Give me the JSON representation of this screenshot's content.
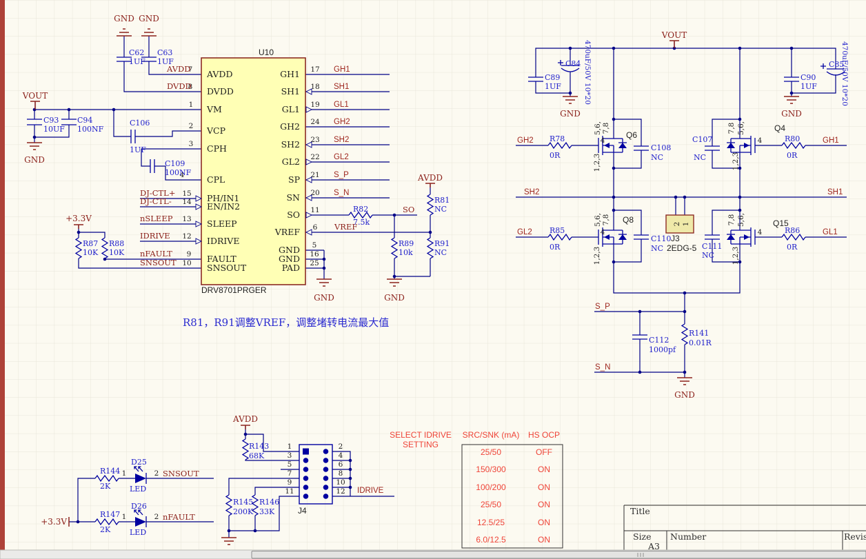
{
  "power": {
    "gnd": "GND",
    "vout": "VOUT",
    "avdd": "AVDD",
    "dvdd": "DVDD",
    "p33": "+3.3V"
  },
  "nets": {
    "so": "SO",
    "vref": "VREF",
    "gh1": "GH1",
    "sh1": "SH1",
    "gl1": "GL1",
    "gh2": "GH2",
    "sh2": "SH2",
    "gl2": "GL2",
    "sp": "S_P",
    "sn": "S_N",
    "idrive": "IDRIVE",
    "snsout": "SNSOUT",
    "nfault": "nFAULT",
    "nsleep": "nSLEEP",
    "djp": "DJ-CTL+",
    "djm": "DJ-CTL-"
  },
  "ic": {
    "refdes": "U10",
    "part": "DRV8701PRGER",
    "left_pins": [
      {
        "num": "7",
        "name": "AVDD"
      },
      {
        "num": "8",
        "name": "DVDD"
      },
      {
        "num": "1",
        "name": "VM"
      },
      {
        "num": "2",
        "name": "VCP"
      },
      {
        "num": "3",
        "name": "CPH"
      },
      {
        "num": "4",
        "name": "CPL"
      },
      {
        "num": "15",
        "name": "PH/IN1"
      },
      {
        "num": "14",
        "name": "EN/IN2"
      },
      {
        "num": "13",
        "name": "SLEEP"
      },
      {
        "num": "12",
        "name": "IDRIVE"
      },
      {
        "num": "9",
        "name": "FAULT"
      },
      {
        "num": "10",
        "name": "SNSOUT"
      }
    ],
    "right_pins": [
      {
        "num": "17",
        "name": "GH1"
      },
      {
        "num": "18",
        "name": "SH1"
      },
      {
        "num": "19",
        "name": "GL1"
      },
      {
        "num": "24",
        "name": "GH2"
      },
      {
        "num": "23",
        "name": "SH2"
      },
      {
        "num": "22",
        "name": "GL2"
      },
      {
        "num": "21",
        "name": "SP"
      },
      {
        "num": "20",
        "name": "SN"
      },
      {
        "num": "11",
        "name": "SO"
      },
      {
        "num": "6",
        "name": "VREF"
      },
      {
        "num": "5",
        "name": "GND"
      },
      {
        "num": "16",
        "name": "GND"
      },
      {
        "num": "25",
        "name": "PAD"
      }
    ]
  },
  "components": {
    "c62": {
      "ref": "C62",
      "val": "1UF"
    },
    "c63": {
      "ref": "C63",
      "val": "1UF"
    },
    "c93": {
      "ref": "C93",
      "val": "10UF"
    },
    "c94": {
      "ref": "C94",
      "val": "100NF"
    },
    "c106": {
      "ref": "C106",
      "val": "1UF"
    },
    "c109": {
      "ref": "C109",
      "val": "100NF"
    },
    "r87": {
      "ref": "R87",
      "val": "10K"
    },
    "r88": {
      "ref": "R88",
      "val": "10K"
    },
    "r82": {
      "ref": "R82",
      "val": "7.5k"
    },
    "r81": {
      "ref": "R81",
      "val": "NC"
    },
    "r89": {
      "ref": "R89",
      "val": "10k"
    },
    "r91": {
      "ref": "R91",
      "val": "NC"
    },
    "c89": {
      "ref": "C89",
      "val": "1UF"
    },
    "c84": {
      "ref": "C84",
      "val": "470uF/50V 10*20"
    },
    "c90": {
      "ref": "C90",
      "val": "1UF"
    },
    "c85": {
      "ref": "C85",
      "val": "470uF/50V 10*20"
    },
    "r78": {
      "ref": "R78",
      "val": "0R"
    },
    "r80": {
      "ref": "R80",
      "val": "0R"
    },
    "r85": {
      "ref": "R85",
      "val": "0R"
    },
    "r86": {
      "ref": "R86",
      "val": "0R"
    },
    "q6": {
      "ref": "Q6"
    },
    "q4": {
      "ref": "Q4"
    },
    "q8": {
      "ref": "Q8"
    },
    "q15": {
      "ref": "Q15"
    },
    "c108": {
      "ref": "C108",
      "val": "NC"
    },
    "c107": {
      "ref": "C107",
      "val": "NC"
    },
    "c110": {
      "ref": "C110",
      "val": "NC"
    },
    "c111": {
      "ref": "C111",
      "val": "NC"
    },
    "j3": {
      "ref": "J3",
      "val": "2EDG-5",
      "pin1": "1",
      "pin2": "2"
    },
    "c112": {
      "ref": "C112",
      "val": "1000pf"
    },
    "r141": {
      "ref": "R141",
      "val": "0.01R"
    },
    "r143": {
      "ref": "R143",
      "val": "68K"
    },
    "r145": {
      "ref": "R145",
      "val": "200K"
    },
    "r146": {
      "ref": "R146",
      "val": "33K"
    },
    "j4": {
      "ref": "J4",
      "left_pins": [
        "1",
        "3",
        "5",
        "7",
        "9",
        "11"
      ],
      "right_pins": [
        "2",
        "4",
        "6",
        "8",
        "10",
        "12"
      ]
    },
    "r144": {
      "ref": "R144",
      "val": "2K"
    },
    "r147": {
      "ref": "R147",
      "val": "2K"
    },
    "d25": {
      "ref": "D25",
      "val": "LED"
    },
    "d26": {
      "ref": "D26",
      "val": "LED"
    }
  },
  "mosfet": {
    "gate_pin": "4",
    "drain_pins_a": "5,6,",
    "drain_pins_b": "7,8",
    "source_pins": "1,2,3"
  },
  "led_pins": {
    "a": "1",
    "k": "2"
  },
  "annotation": "R81，R91调整VREF，调整堵转电流最大值",
  "idrive_table": {
    "title1": "SELECT IDRIVE",
    "title2": "SETTING",
    "col_src": "SRC/SNK (mA)",
    "col_ocp": "HS OCP",
    "rows": [
      {
        "src": "25/50",
        "ocp": "OFF"
      },
      {
        "src": "150/300",
        "ocp": "ON"
      },
      {
        "src": "100/200",
        "ocp": "ON"
      },
      {
        "src": "25/50",
        "ocp": "ON"
      },
      {
        "src": "12.5/25",
        "ocp": "ON"
      },
      {
        "src": "6.0/12.5",
        "ocp": "ON"
      }
    ]
  },
  "title_block": {
    "title": "Title",
    "size": "Size",
    "size_val": "A3",
    "number": "Number",
    "revision": "Revision"
  }
}
